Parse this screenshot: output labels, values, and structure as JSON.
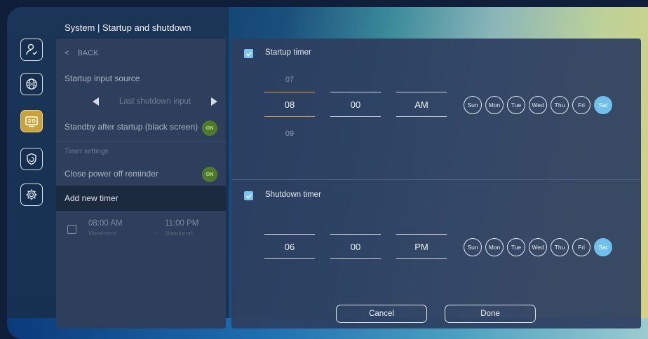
{
  "header": {
    "title": "System | Startup and shutdown"
  },
  "rail": {
    "items": [
      "user-icon",
      "network-icon",
      "display-settings-icon",
      "security-icon",
      "system-icon"
    ]
  },
  "menu": {
    "back_label": "BACK",
    "startup_source_label": "Startup input source",
    "startup_source_value": "Last shutdown input",
    "standby_label": "Standby after startup (black screen)",
    "standby_toggle": "ON",
    "timer_settings_label": "Timer settings",
    "close_reminder_label": "Close power off reminder",
    "close_reminder_toggle": "ON",
    "add_new_timer_label": "Add new timer",
    "timer_entry": {
      "start_time": "08:00 AM",
      "start_days": "Weekend",
      "separator": "~",
      "end_time": "11:00 PM",
      "end_days": "Weekend"
    }
  },
  "startup": {
    "title": "Startup timer",
    "hour_prev": "07",
    "hour": "08",
    "hour_next": "09",
    "minute": "00",
    "ampm": "AM",
    "days": [
      "Sun",
      "Mon",
      "Tue",
      "Wed",
      "Thu",
      "Fri",
      "Sat"
    ],
    "selected_day": "Sat"
  },
  "shutdown": {
    "title": "Shutdown timer",
    "hour": "06",
    "minute": "00",
    "ampm": "PM",
    "days": [
      "Sun",
      "Mon",
      "Tue",
      "Wed",
      "Thu",
      "Fri",
      "Sat"
    ],
    "selected_day": "Sat"
  },
  "actions": {
    "cancel": "Cancel",
    "done": "Done"
  },
  "colors": {
    "accent": "#6fc0ea",
    "active_field": "#e5a33a",
    "active_rail": "#c8a23a"
  }
}
